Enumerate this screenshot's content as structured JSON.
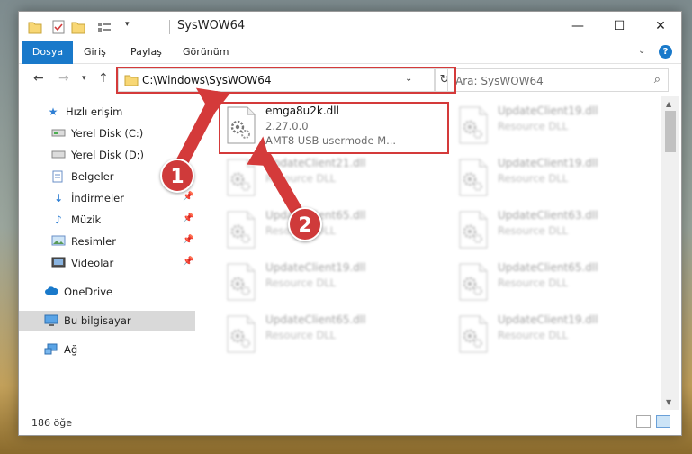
{
  "window": {
    "title": "SysWOW64",
    "controls": {
      "minimize": "—",
      "maximize": "☐",
      "close": "✕"
    }
  },
  "ribbon": {
    "tabs": [
      {
        "label": "Dosya"
      },
      {
        "label": "Giriş"
      },
      {
        "label": "Paylaş"
      },
      {
        "label": "Görünüm"
      }
    ],
    "help": "?"
  },
  "navigation": {
    "address": "C:\\Windows\\SysWOW64",
    "search_placeholder": "Ara: SysWOW64"
  },
  "sidebar": {
    "items": [
      {
        "label": "Hızlı erişim",
        "icon": "star-icon",
        "pinned": false
      },
      {
        "label": "Yerel Disk (C:)",
        "icon": "drive-icon",
        "pinned": false
      },
      {
        "label": "Yerel Disk (D:)",
        "icon": "drive-icon",
        "pinned": true
      },
      {
        "label": "Belgeler",
        "icon": "documents-icon",
        "pinned": true
      },
      {
        "label": "İndirmeler",
        "icon": "download-icon",
        "pinned": true
      },
      {
        "label": "Müzik",
        "icon": "music-icon",
        "pinned": true
      },
      {
        "label": "Resimler",
        "icon": "pictures-icon",
        "pinned": true
      },
      {
        "label": "Videolar",
        "icon": "videos-icon",
        "pinned": true
      },
      {
        "label": "OneDrive",
        "icon": "cloud-icon",
        "pinned": false
      },
      {
        "label": "Bu bilgisayar",
        "icon": "computer-icon",
        "pinned": false,
        "selected": true
      },
      {
        "label": "Ağ",
        "icon": "network-icon",
        "pinned": false
      }
    ]
  },
  "files": [
    {
      "name": "emga8u2k.dll",
      "version": "2.27.0.0",
      "description": "AMT8 USB usermode M...",
      "highlighted": true
    },
    {
      "name": "UpdateClient19.dll",
      "version": "Resource DLL",
      "blurred": true
    },
    {
      "name": "UpdateClient21.dll",
      "version": "Resource DLL",
      "blurred": true
    },
    {
      "name": "UpdateClient19.dll",
      "version": "Resource DLL",
      "blurred": true
    },
    {
      "name": "UpdateClient65.dll",
      "version": "Resource DLL",
      "blurred": true
    },
    {
      "name": "UpdateClient63.dll",
      "version": "Resource DLL",
      "blurred": true
    },
    {
      "name": "UpdateClient19.dll",
      "version": "Resource DLL",
      "blurred": true
    },
    {
      "name": "UpdateClient65.dll",
      "version": "Resource DLL",
      "blurred": true
    },
    {
      "name": "UpdateClient65.dll",
      "version": "Resource DLL",
      "blurred": true
    },
    {
      "name": "UpdateClient19.dll",
      "version": "Resource DLL",
      "blurred": true
    }
  ],
  "status": {
    "item_count": "186 öğe"
  },
  "annotations": {
    "step1": "1",
    "step2": "2"
  },
  "colors": {
    "accent": "#1979ca",
    "highlight": "#d43a3a",
    "folder": "#f8d775",
    "selected": "#d9d9d9"
  }
}
